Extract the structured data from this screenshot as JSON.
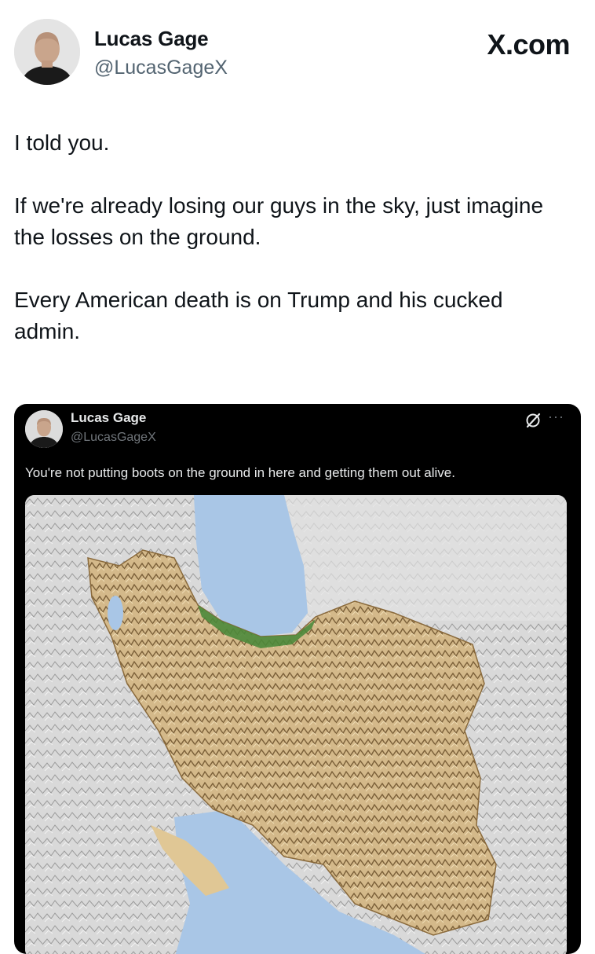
{
  "author": {
    "name": "Lucas Gage",
    "handle": "@LucasGageX",
    "avatar_icon": "profile-photo"
  },
  "brand": "X.com",
  "tweet": {
    "paragraphs": [
      "I told you.",
      "If we're already losing our guys in the sky, just imagine the losses on the ground.",
      "Every American death is on Trump and his cucked admin."
    ]
  },
  "quoted_post": {
    "name": "Lucas Gage",
    "handle": "@LucasGageX",
    "text": "You're not putting boots on the ground in here and getting them out alive.",
    "more_label": "···",
    "verified_icon": "grok-icon",
    "image_icon": "terrain-map"
  },
  "colors": {
    "text_primary": "#0f1419",
    "text_secondary": "#536471",
    "card_background": "#000000",
    "card_text": "#e7e9ea",
    "card_muted": "#71767b",
    "water": "#a9c6e6",
    "terrain": "#c9ab77",
    "vegetation": "#4d8a3b"
  }
}
